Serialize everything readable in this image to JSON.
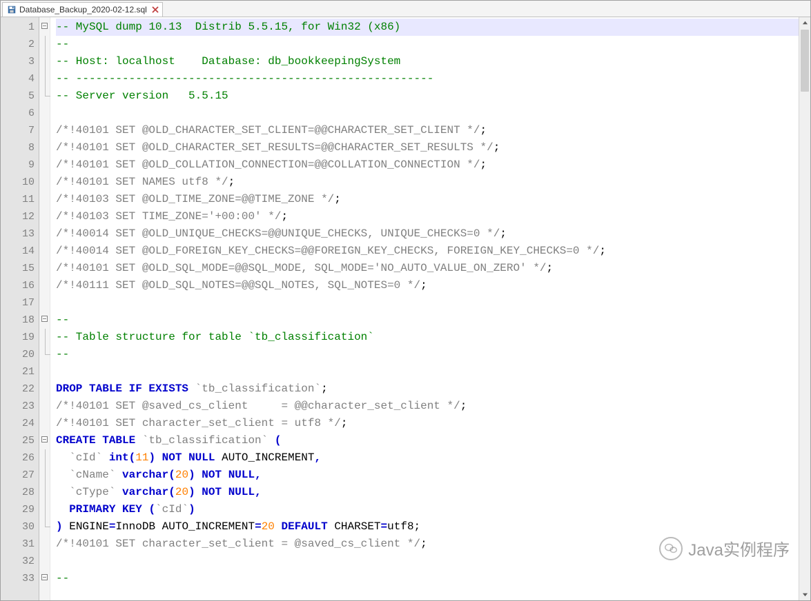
{
  "tab": {
    "filename": "Database_Backup_2020-02-12.sql"
  },
  "gutter": {
    "start": 1,
    "end": 33
  },
  "fold_markers": {
    "1": "minus",
    "18": "minus",
    "25": "minus",
    "33": "minus"
  },
  "code_lines": [
    {
      "n": 1,
      "highlight": true,
      "segs": [
        [
          "c-comment",
          "-- MySQL dump 10.13  Distrib 5.5.15, for Win32 (x86)"
        ]
      ]
    },
    {
      "n": 2,
      "segs": [
        [
          "c-comment",
          "--"
        ]
      ]
    },
    {
      "n": 3,
      "segs": [
        [
          "c-comment",
          "-- Host: localhost    Database: db_bookkeepingSystem"
        ]
      ]
    },
    {
      "n": 4,
      "segs": [
        [
          "c-comment",
          "-- ------------------------------------------------------"
        ]
      ]
    },
    {
      "n": 5,
      "segs": [
        [
          "c-comment",
          "-- Server version   5.5.15"
        ]
      ]
    },
    {
      "n": 6,
      "segs": []
    },
    {
      "n": 7,
      "segs": [
        [
          "c-gray",
          "/*!40101 SET @OLD_CHARACTER_SET_CLIENT=@@CHARACTER_SET_CLIENT */"
        ],
        [
          "c-black",
          ";"
        ]
      ]
    },
    {
      "n": 8,
      "segs": [
        [
          "c-gray",
          "/*!40101 SET @OLD_CHARACTER_SET_RESULTS=@@CHARACTER_SET_RESULTS */"
        ],
        [
          "c-black",
          ";"
        ]
      ]
    },
    {
      "n": 9,
      "segs": [
        [
          "c-gray",
          "/*!40101 SET @OLD_COLLATION_CONNECTION=@@COLLATION_CONNECTION */"
        ],
        [
          "c-black",
          ";"
        ]
      ]
    },
    {
      "n": 10,
      "segs": [
        [
          "c-gray",
          "/*!40101 SET NAMES utf8 */"
        ],
        [
          "c-black",
          ";"
        ]
      ]
    },
    {
      "n": 11,
      "segs": [
        [
          "c-gray",
          "/*!40103 SET @OLD_TIME_ZONE=@@TIME_ZONE */"
        ],
        [
          "c-black",
          ";"
        ]
      ]
    },
    {
      "n": 12,
      "segs": [
        [
          "c-gray",
          "/*!40103 SET TIME_ZONE='+00:00' */"
        ],
        [
          "c-black",
          ";"
        ]
      ]
    },
    {
      "n": 13,
      "segs": [
        [
          "c-gray",
          "/*!40014 SET @OLD_UNIQUE_CHECKS=@@UNIQUE_CHECKS, UNIQUE_CHECKS=0 */"
        ],
        [
          "c-black",
          ";"
        ]
      ]
    },
    {
      "n": 14,
      "segs": [
        [
          "c-gray",
          "/*!40014 SET @OLD_FOREIGN_KEY_CHECKS=@@FOREIGN_KEY_CHECKS, FOREIGN_KEY_CHECKS=0 */"
        ],
        [
          "c-black",
          ";"
        ]
      ]
    },
    {
      "n": 15,
      "segs": [
        [
          "c-gray",
          "/*!40101 SET @OLD_SQL_MODE=@@SQL_MODE, SQL_MODE='NO_AUTO_VALUE_ON_ZERO' */"
        ],
        [
          "c-black",
          ";"
        ]
      ]
    },
    {
      "n": 16,
      "segs": [
        [
          "c-gray",
          "/*!40111 SET @OLD_SQL_NOTES=@@SQL_NOTES, SQL_NOTES=0 */"
        ],
        [
          "c-black",
          ";"
        ]
      ]
    },
    {
      "n": 17,
      "segs": []
    },
    {
      "n": 18,
      "segs": [
        [
          "c-comment",
          "--"
        ]
      ]
    },
    {
      "n": 19,
      "segs": [
        [
          "c-comment",
          "-- Table structure for table `tb_classification`"
        ]
      ]
    },
    {
      "n": 20,
      "segs": [
        [
          "c-comment",
          "--"
        ]
      ]
    },
    {
      "n": 21,
      "segs": []
    },
    {
      "n": 22,
      "segs": [
        [
          "c-kw",
          "DROP TABLE IF EXISTS"
        ],
        [
          "c-black",
          " "
        ],
        [
          "c-str",
          "`tb_classification`"
        ],
        [
          "c-black",
          ";"
        ]
      ]
    },
    {
      "n": 23,
      "segs": [
        [
          "c-gray",
          "/*!40101 SET @saved_cs_client     = @@character_set_client */"
        ],
        [
          "c-black",
          ";"
        ]
      ]
    },
    {
      "n": 24,
      "segs": [
        [
          "c-gray",
          "/*!40101 SET character_set_client = utf8 */"
        ],
        [
          "c-black",
          ";"
        ]
      ]
    },
    {
      "n": 25,
      "segs": [
        [
          "c-kw",
          "CREATE TABLE"
        ],
        [
          "c-black",
          " "
        ],
        [
          "c-str",
          "`tb_classification`"
        ],
        [
          "c-black",
          " "
        ],
        [
          "c-kw",
          "("
        ]
      ]
    },
    {
      "n": 26,
      "segs": [
        [
          "c-black",
          "  "
        ],
        [
          "c-str",
          "`cId`"
        ],
        [
          "c-black",
          " "
        ],
        [
          "c-kw",
          "int"
        ],
        [
          "c-kw",
          "("
        ],
        [
          "c-num",
          "11"
        ],
        [
          "c-kw",
          ")"
        ],
        [
          "c-black",
          " "
        ],
        [
          "c-kw",
          "NOT NULL"
        ],
        [
          "c-black",
          " AUTO_INCREMENT"
        ],
        [
          "c-kw",
          ","
        ]
      ]
    },
    {
      "n": 27,
      "segs": [
        [
          "c-black",
          "  "
        ],
        [
          "c-str",
          "`cName`"
        ],
        [
          "c-black",
          " "
        ],
        [
          "c-kw",
          "varchar"
        ],
        [
          "c-kw",
          "("
        ],
        [
          "c-num",
          "20"
        ],
        [
          "c-kw",
          ")"
        ],
        [
          "c-black",
          " "
        ],
        [
          "c-kw",
          "NOT NULL"
        ],
        [
          "c-kw",
          ","
        ]
      ]
    },
    {
      "n": 28,
      "segs": [
        [
          "c-black",
          "  "
        ],
        [
          "c-str",
          "`cType`"
        ],
        [
          "c-black",
          " "
        ],
        [
          "c-kw",
          "varchar"
        ],
        [
          "c-kw",
          "("
        ],
        [
          "c-num",
          "20"
        ],
        [
          "c-kw",
          ")"
        ],
        [
          "c-black",
          " "
        ],
        [
          "c-kw",
          "NOT NULL"
        ],
        [
          "c-kw",
          ","
        ]
      ]
    },
    {
      "n": 29,
      "segs": [
        [
          "c-black",
          "  "
        ],
        [
          "c-kw",
          "PRIMARY KEY"
        ],
        [
          "c-black",
          " "
        ],
        [
          "c-kw",
          "("
        ],
        [
          "c-str",
          "`cId`"
        ],
        [
          "c-kw",
          ")"
        ]
      ]
    },
    {
      "n": 30,
      "segs": [
        [
          "c-kw",
          ")"
        ],
        [
          "c-black",
          " ENGINE"
        ],
        [
          "c-kw",
          "="
        ],
        [
          "c-black",
          "InnoDB AUTO_INCREMENT"
        ],
        [
          "c-kw",
          "="
        ],
        [
          "c-num",
          "20"
        ],
        [
          "c-black",
          " "
        ],
        [
          "c-kw",
          "DEFAULT"
        ],
        [
          "c-black",
          " CHARSET"
        ],
        [
          "c-kw",
          "="
        ],
        [
          "c-black",
          "utf8"
        ],
        [
          "c-black",
          ";"
        ]
      ]
    },
    {
      "n": 31,
      "segs": [
        [
          "c-gray",
          "/*!40101 SET character_set_client = @saved_cs_client */"
        ],
        [
          "c-black",
          ";"
        ]
      ]
    },
    {
      "n": 32,
      "segs": []
    },
    {
      "n": 33,
      "segs": [
        [
          "c-comment",
          "--"
        ]
      ]
    }
  ],
  "watermark": {
    "text": "Java实例程序"
  }
}
